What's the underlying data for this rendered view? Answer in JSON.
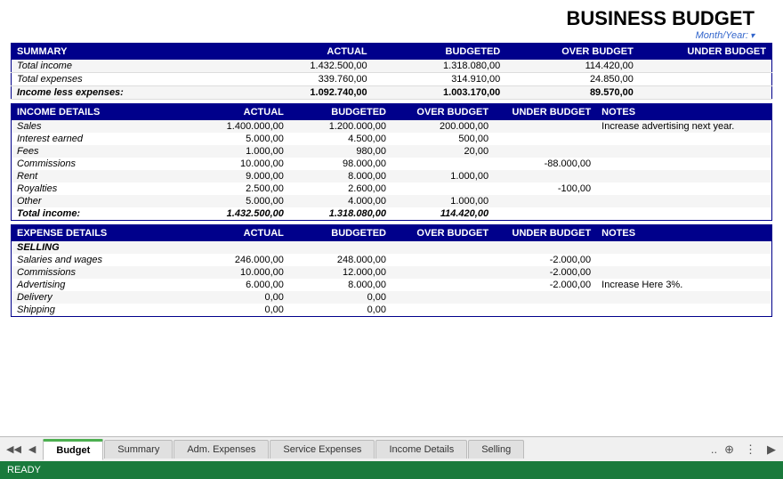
{
  "title": "BUSINESS BUDGET",
  "month_year_label": "Month/Year:",
  "summary": {
    "header": "SUMMARY",
    "columns": [
      "",
      "ACTUAL",
      "BUDGETED",
      "OVER BUDGET",
      "UNDER BUDGET"
    ],
    "rows": [
      {
        "label": "Total income",
        "actual": "1.432.500,00",
        "budgeted": "1.318.080,00",
        "over": "114.420,00",
        "under": ""
      },
      {
        "label": "Total expenses",
        "actual": "339.760,00",
        "budgeted": "314.910,00",
        "over": "24.850,00",
        "under": ""
      },
      {
        "label": "Income less expenses:",
        "actual": "1.092.740,00",
        "budgeted": "1.003.170,00",
        "over": "89.570,00",
        "under": ""
      }
    ]
  },
  "income_details": {
    "header": "INCOME DETAILS",
    "columns": [
      "",
      "ACTUAL",
      "BUDGETED",
      "OVER BUDGET",
      "UNDER BUDGET",
      "NOTES"
    ],
    "rows": [
      {
        "label": "Sales",
        "actual": "1.400.000,00",
        "budgeted": "1.200.000,00",
        "over": "200.000,00",
        "under": "",
        "notes": "Increase advertising next year."
      },
      {
        "label": "Interest earned",
        "actual": "5.000,00",
        "budgeted": "4.500,00",
        "over": "500,00",
        "under": "",
        "notes": ""
      },
      {
        "label": "Fees",
        "actual": "1.000,00",
        "budgeted": "980,00",
        "over": "20,00",
        "under": "",
        "notes": ""
      },
      {
        "label": "Commissions",
        "actual": "10.000,00",
        "budgeted": "98.000,00",
        "over": "",
        "under": "-88.000,00",
        "notes": ""
      },
      {
        "label": "Rent",
        "actual": "9.000,00",
        "budgeted": "8.000,00",
        "over": "1.000,00",
        "under": "",
        "notes": ""
      },
      {
        "label": "Royalties",
        "actual": "2.500,00",
        "budgeted": "2.600,00",
        "over": "",
        "under": "-100,00",
        "notes": ""
      },
      {
        "label": "Other",
        "actual": "5.000,00",
        "budgeted": "4.000,00",
        "over": "1.000,00",
        "under": "",
        "notes": ""
      },
      {
        "label": "Total income:",
        "actual": "1.432.500,00",
        "budgeted": "1.318.080,00",
        "over": "114.420,00",
        "under": "",
        "notes": ""
      }
    ]
  },
  "expense_details": {
    "header": "EXPENSE DETAILS",
    "columns": [
      "",
      "ACTUAL",
      "BUDGETED",
      "OVER BUDGET",
      "UNDER BUDGET",
      "NOTES"
    ],
    "selling_label": "SELLING",
    "rows": [
      {
        "label": "Salaries and wages",
        "actual": "246.000,00",
        "budgeted": "248.000,00",
        "over": "",
        "under": "-2.000,00",
        "notes": ""
      },
      {
        "label": "Commissions",
        "actual": "10.000,00",
        "budgeted": "12.000,00",
        "over": "",
        "under": "-2.000,00",
        "notes": ""
      },
      {
        "label": "Advertising",
        "actual": "6.000,00",
        "budgeted": "8.000,00",
        "over": "",
        "under": "-2.000,00",
        "notes": "Increase Here 3%."
      },
      {
        "label": "Delivery",
        "actual": "0,00",
        "budgeted": "0,00",
        "over": "",
        "under": "",
        "notes": ""
      },
      {
        "label": "Shipping",
        "actual": "0,00",
        "budgeted": "0,00",
        "over": "",
        "under": "",
        "notes": ""
      }
    ]
  },
  "tabs": [
    "Budget",
    "Summary",
    "Adm. Expenses",
    "Service Expenses",
    "Income Details",
    "Selling"
  ],
  "active_tab": "Budget",
  "status": "READY"
}
